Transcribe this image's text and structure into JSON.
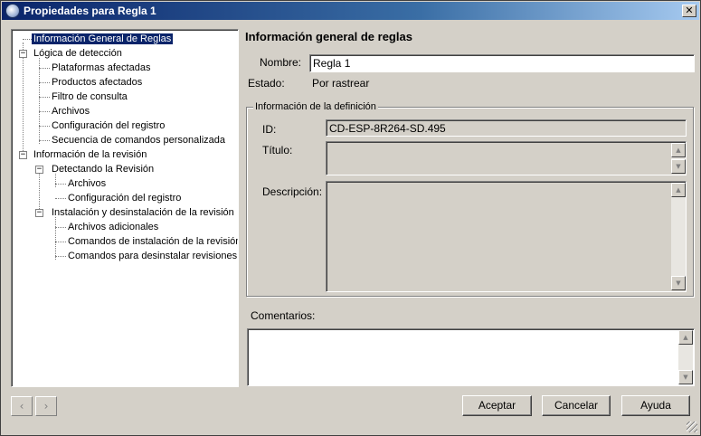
{
  "window": {
    "title": "Propiedades para Regla 1"
  },
  "tree": {
    "items": [
      {
        "label": "Información General de Reglas"
      },
      {
        "label": "Lógica de detección"
      },
      {
        "label": "Plataformas afectadas"
      },
      {
        "label": "Productos afectados"
      },
      {
        "label": "Filtro de consulta"
      },
      {
        "label": "Archivos"
      },
      {
        "label": "Configuración del registro"
      },
      {
        "label": "Secuencia de comandos personalizada"
      },
      {
        "label": "Información de la revisión"
      },
      {
        "label": "Detectando la Revisión"
      },
      {
        "label": "Archivos"
      },
      {
        "label": "Configuración del registro"
      },
      {
        "label": "Instalación y desinstalación de la revisión"
      },
      {
        "label": "Archivos adicionales"
      },
      {
        "label": "Comandos de instalación de la revisión"
      },
      {
        "label": "Comandos para desinstalar revisiones"
      }
    ]
  },
  "main": {
    "section_title": "Información general de reglas",
    "name_label": "Nombre:",
    "name_value": "Regla 1",
    "state_label": "Estado:",
    "state_value": "Por rastrear",
    "definition": {
      "legend": "Información de la definición",
      "id_label": "ID:",
      "id_value": "CD-ESP-8R264-SD.495",
      "title_label": "Título:",
      "title_value": "",
      "description_label": "Descripción:",
      "description_value": ""
    },
    "comments_label": "Comentarios:",
    "comments_value": ""
  },
  "buttons": {
    "accept": "Aceptar",
    "cancel": "Cancelar",
    "help": "Ayuda",
    "back": "‹",
    "forward": "›"
  }
}
